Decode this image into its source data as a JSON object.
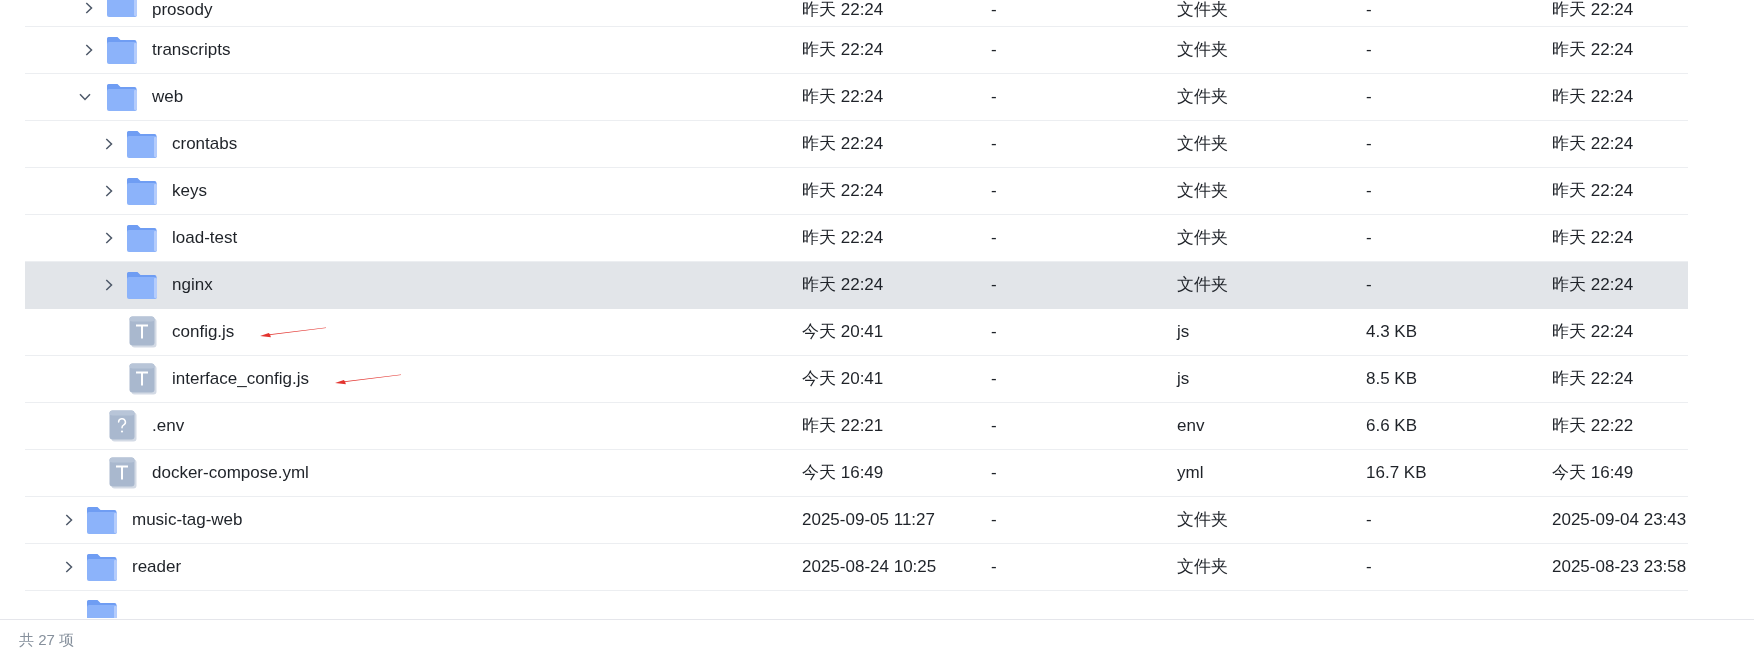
{
  "rows": [
    {
      "children": [
        {
          "kind": "folder",
          "name": "prosody",
          "expanded": false,
          "highlighted": false,
          "annotated": false,
          "cut_off_top": true,
          "cells": [
            "昨天 22:24",
            "-",
            "文件夹",
            "-",
            "昨天 22:24"
          ]
        },
        {
          "kind": "folder",
          "name": "transcripts",
          "expanded": false,
          "highlighted": false,
          "annotated": false,
          "cells": [
            "昨天 22:24",
            "-",
            "文件夹",
            "-",
            "昨天 22:24"
          ]
        },
        {
          "kind": "folder",
          "name": "web",
          "expanded": true,
          "highlighted": false,
          "annotated": false,
          "cells": [
            "昨天 22:24",
            "-",
            "文件夹",
            "-",
            "昨天 22:24"
          ],
          "children": [
            {
              "kind": "folder",
              "name": "crontabs",
              "expanded": false,
              "highlighted": false,
              "annotated": false,
              "cells": [
                "昨天 22:24",
                "-",
                "文件夹",
                "-",
                "昨天 22:24"
              ]
            },
            {
              "kind": "folder",
              "name": "keys",
              "expanded": false,
              "highlighted": false,
              "annotated": false,
              "cells": [
                "昨天 22:24",
                "-",
                "文件夹",
                "-",
                "昨天 22:24"
              ]
            },
            {
              "kind": "folder",
              "name": "load-test",
              "expanded": false,
              "highlighted": false,
              "annotated": false,
              "cells": [
                "昨天 22:24",
                "-",
                "文件夹",
                "-",
                "昨天 22:24"
              ]
            },
            {
              "kind": "folder",
              "name": "nginx",
              "expanded": false,
              "highlighted": true,
              "annotated": false,
              "cells": [
                "昨天 22:24",
                "-",
                "文件夹",
                "-",
                "昨天 22:24"
              ]
            },
            {
              "kind": "text_file",
              "name": "config.js",
              "highlighted": false,
              "annotated": true,
              "cells": [
                "今天 20:41",
                "-",
                "js",
                "4.3 KB",
                "昨天 22:24"
              ]
            },
            {
              "kind": "text_file",
              "name": "interface_config.js",
              "highlighted": false,
              "annotated": true,
              "cells": [
                "今天 20:41",
                "-",
                "js",
                "8.5 KB",
                "昨天 22:24"
              ]
            }
          ]
        },
        {
          "kind": "unknown_file",
          "name": ".env",
          "highlighted": false,
          "annotated": false,
          "cells": [
            "昨天 22:21",
            "-",
            "env",
            "6.6 KB",
            "昨天 22:22"
          ]
        },
        {
          "kind": "text_file",
          "name": "docker-compose.yml",
          "highlighted": false,
          "annotated": false,
          "cells": [
            "今天 16:49",
            "-",
            "yml",
            "16.7 KB",
            "今天 16:49"
          ]
        }
      ]
    },
    {
      "kind": "folder",
      "name": "music-tag-web",
      "expanded": false,
      "highlighted": false,
      "annotated": false,
      "cells": [
        "2025-09-05 11:27",
        "-",
        "文件夹",
        "-",
        "2025-09-04 23:43"
      ]
    },
    {
      "kind": "folder",
      "name": "reader",
      "expanded": false,
      "highlighted": false,
      "annotated": false,
      "cells": [
        "2025-08-24 10:25",
        "-",
        "文件夹",
        "-",
        "2025-08-23 23:58"
      ]
    },
    {
      "kind": "folder",
      "highlighted": false,
      "annotated": false,
      "cut_off_bottom": true
    }
  ],
  "status_bar": {
    "text": "共 27 项"
  }
}
